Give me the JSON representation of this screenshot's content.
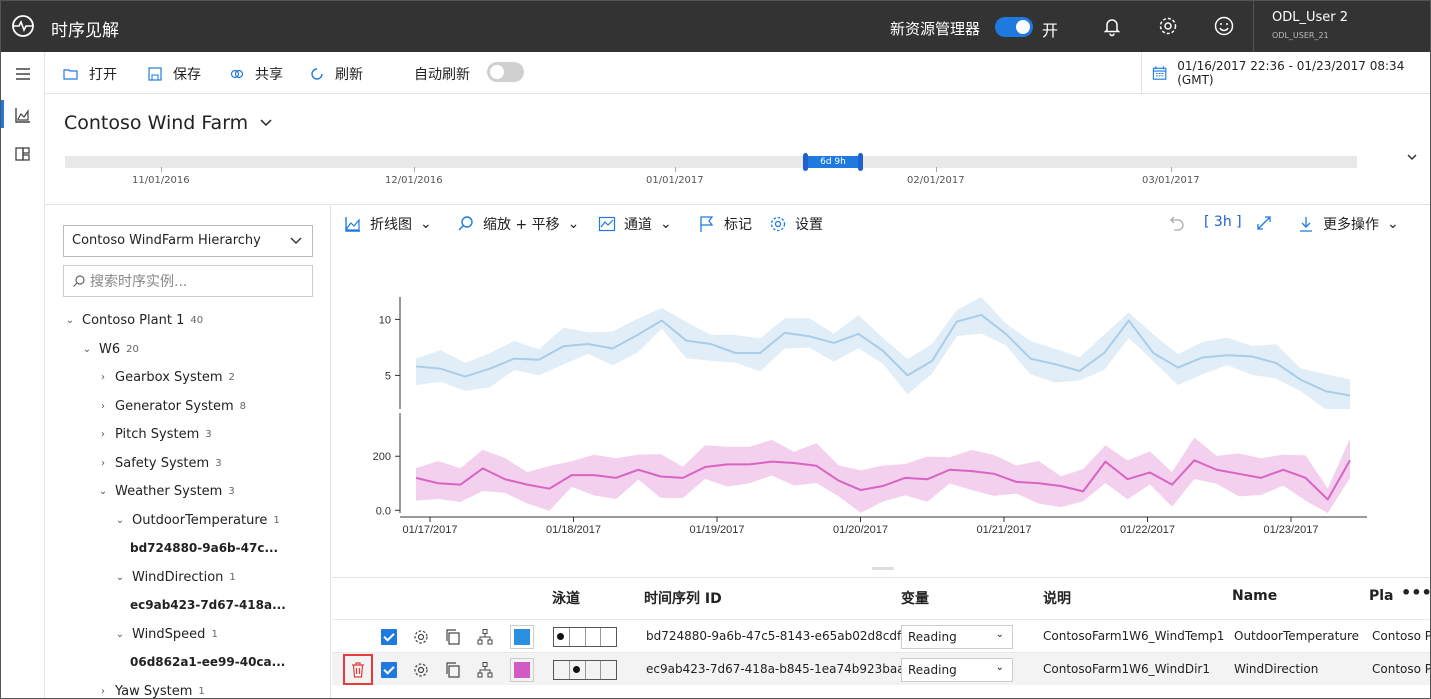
{
  "app": {
    "title": "时序见解",
    "new_explorer_label": "新资源管理器",
    "toggle_state": "开",
    "user_name": "ODL_User 2",
    "user_id": "ODL_USER_21"
  },
  "commands": {
    "open": "打开",
    "save": "保存",
    "share": "共享",
    "refresh": "刷新",
    "auto_refresh": "自动刷新"
  },
  "date_range": "01/16/2017 22:36 - 01/23/2017 08:34 (GMT)",
  "environment": {
    "name": "Contoso Wind Farm"
  },
  "timeline": {
    "brush_label": "6d 9h",
    "ticks": [
      "11/01/2016",
      "12/01/2016",
      "01/01/2017",
      "02/01/2017",
      "03/01/2017"
    ]
  },
  "hierarchy": {
    "selected": "Contoso WindFarm Hierarchy",
    "search_placeholder": "搜索时序实例...",
    "items": [
      {
        "label": "Contoso Plant 1",
        "count": "40",
        "arrow": "⌄"
      },
      {
        "label": "W6",
        "count": "20",
        "arrow": "⌄"
      },
      {
        "label": "Gearbox System",
        "count": "2",
        "arrow": "›"
      },
      {
        "label": "Generator System",
        "count": "8",
        "arrow": "›"
      },
      {
        "label": "Pitch System",
        "count": "3",
        "arrow": "›"
      },
      {
        "label": "Safety System",
        "count": "3",
        "arrow": "›"
      },
      {
        "label": "Weather System",
        "count": "3",
        "arrow": "⌄"
      },
      {
        "label": "OutdoorTemperature",
        "count": "1",
        "arrow": "⌄"
      },
      {
        "label": "bd724880-9a6b-47c...",
        "count": "",
        "arrow": ""
      },
      {
        "label": "WindDirection",
        "count": "1",
        "arrow": "⌄"
      },
      {
        "label": "ec9ab423-7d67-418a...",
        "count": "",
        "arrow": ""
      },
      {
        "label": "WindSpeed",
        "count": "1",
        "arrow": "⌄"
      },
      {
        "label": "06d862a1-ee99-40ca...",
        "count": "",
        "arrow": ""
      },
      {
        "label": "Yaw System",
        "count": "1",
        "arrow": "›"
      }
    ]
  },
  "chart_toolbar": {
    "line_chart": "折线图",
    "zoom_pan": "缩放 + 平移",
    "channel": "通道",
    "marker": "标记",
    "settings": "设置",
    "interval": "[ 3h ]",
    "more": "更多操作"
  },
  "chart_data": {
    "type": "line",
    "x": [
      "01/17/2017",
      "01/18/2017",
      "01/19/2017",
      "01/20/2017",
      "01/21/2017",
      "01/22/2017",
      "01/23/2017"
    ],
    "series": [
      {
        "name": "",
        "color": "#a9cde9",
        "yticks": [
          "10",
          "5"
        ],
        "ylim": [
          2,
          12
        ],
        "values": [
          5.8,
          5.6,
          4.9,
          5.6,
          6.5,
          6.4,
          7.6,
          7.8,
          7.4,
          8.6,
          9.9,
          8.1,
          7.8,
          7.0,
          7.0,
          8.8,
          8.5,
          7.9,
          8.7,
          7.2,
          5.0,
          6.3,
          9.8,
          10.4,
          8.7,
          6.5,
          6.0,
          5.4,
          7.0,
          9.9,
          7.0,
          5.7,
          6.6,
          6.8,
          6.7,
          6.1,
          4.6,
          3.6,
          3.2
        ]
      },
      {
        "name": "",
        "color": "#d864c4",
        "yticks": [
          "200",
          "0.0"
        ],
        "ylim": [
          -10,
          360
        ],
        "values": [
          120,
          100,
          95,
          155,
          115,
          95,
          80,
          130,
          130,
          120,
          150,
          125,
          120,
          160,
          170,
          170,
          180,
          175,
          165,
          110,
          75,
          90,
          120,
          115,
          150,
          145,
          135,
          105,
          100,
          90,
          70,
          180,
          115,
          140,
          95,
          185,
          150,
          135,
          120,
          150,
          120,
          40,
          185
        ]
      }
    ]
  },
  "grid": {
    "headers": {
      "lane": "泳道",
      "ts_id": "时间序列 ID",
      "variable": "变量",
      "description": "说明",
      "name": "Name",
      "plant": "Pla"
    },
    "rows": [
      {
        "ts_id": "bd724880-9a6b-47c5-8143-e65ab02d8cdf",
        "variable": "Reading",
        "description": "ContosoFarm1W6_WindTemp1",
        "name": "OutdoorTemperature",
        "plant": "Contoso Pla",
        "color": "#2b8fe0"
      },
      {
        "ts_id": "ec9ab423-7d67-418a-b845-1ea74b923baa",
        "variable": "Reading",
        "description": "ContosoFarm1W6_WindDir1",
        "name": "WindDirection",
        "plant": "Contoso Pla",
        "color": "#d15ac3"
      }
    ]
  }
}
